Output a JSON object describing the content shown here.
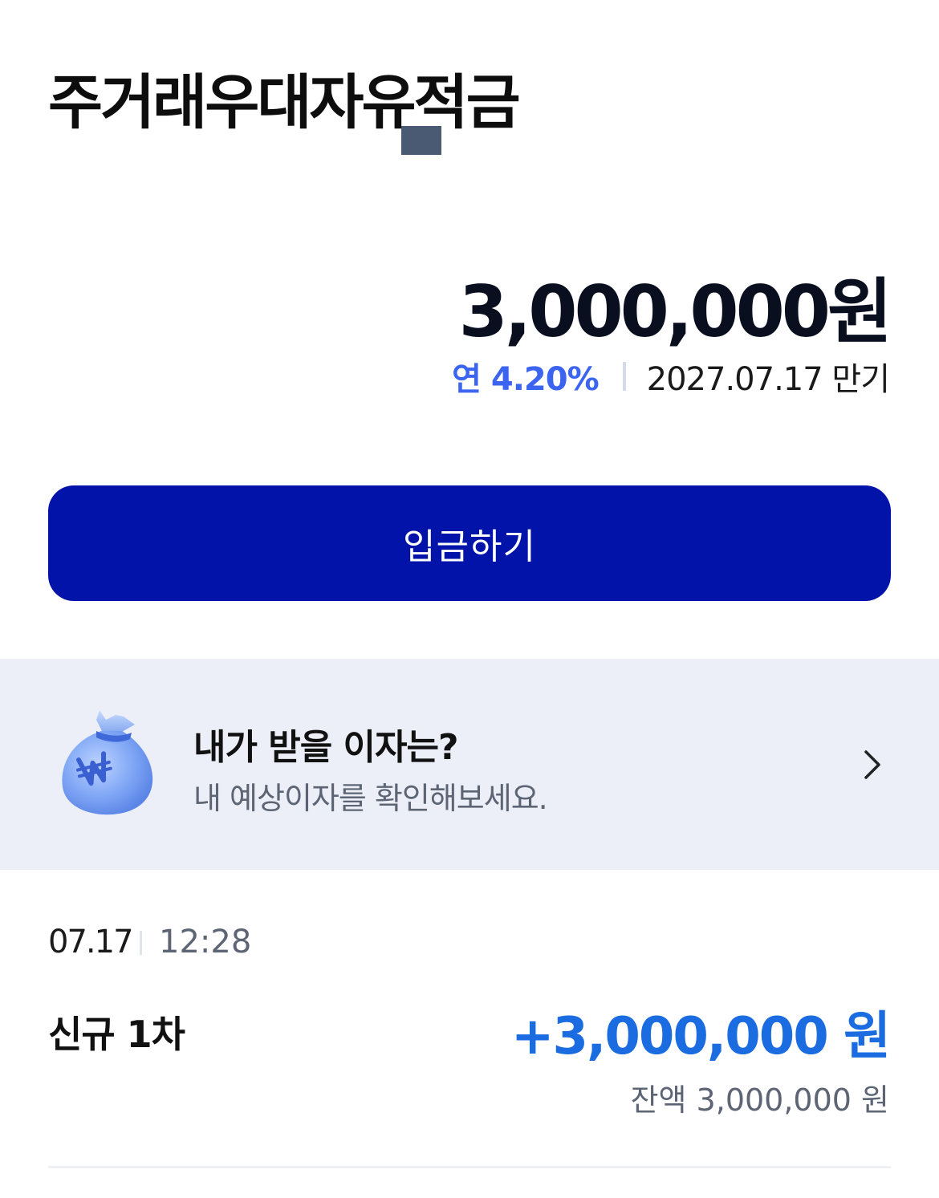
{
  "product": {
    "title": "주거래우대자유적금",
    "balance": "3,000,000원",
    "rate": "연 4.20%",
    "maturity": "2027.07.17 만기"
  },
  "actions": {
    "deposit_label": "입금하기"
  },
  "interest_banner": {
    "title": "내가 받을 이자는?",
    "subtitle": "내 예상이자를 확인해보세요.",
    "icon": "money-bag-icon",
    "coin_symbol": "₩"
  },
  "transactions": [
    {
      "date": "07.17",
      "time": "12:28",
      "label": "신규 1차",
      "amount": "+3,000,000 원",
      "balance": "잔액 3,000,000 원"
    }
  ],
  "colors": {
    "primary_button": "#0213aa",
    "rate_accent": "#3b64f0",
    "amount_positive": "#1b6ce0",
    "banner_bg": "#eceff7"
  }
}
